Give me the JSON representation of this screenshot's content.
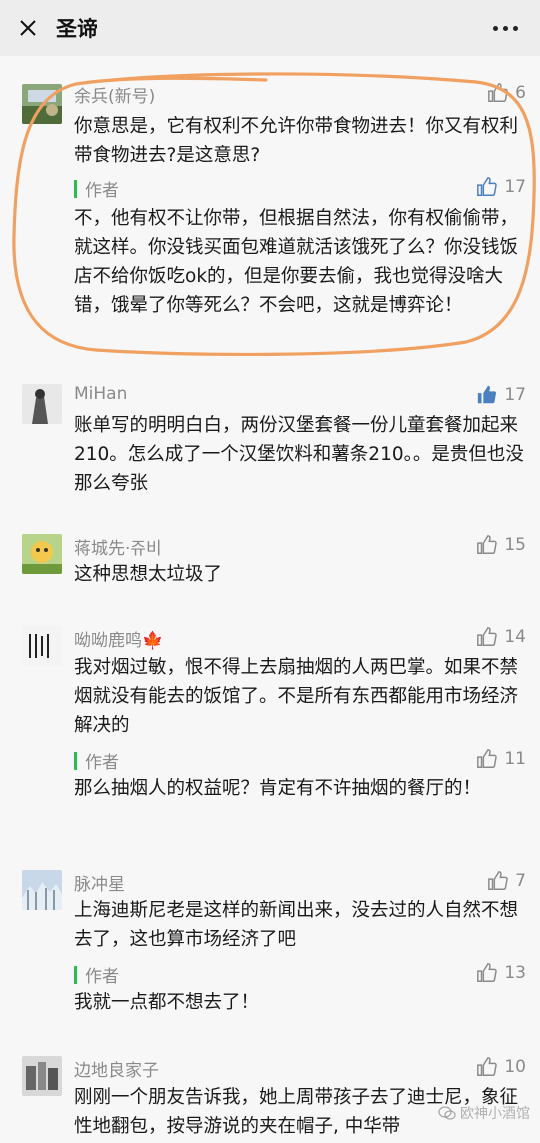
{
  "header": {
    "title": "圣谛"
  },
  "comments": [
    {
      "name": "余兵(新号)",
      "likes": "6",
      "text": "你意思是，它有权利不允许你带食物进去！你又有权利带食物进去?是这意思?",
      "reply": {
        "label": "作者",
        "likes": "17",
        "text": "不，他有权不让你带，但根据自然法，你有权偷偷带，就这样。你没钱买面包难道就活该饿死了么？你没钱饭店不给你饭吃ok的，但是你要去偷，我也觉得没啥大错，饿晕了你等死么？不会吧，这就是博弈论！"
      }
    },
    {
      "name": "MiHan",
      "likes": "17",
      "text": "账单写的明明白白，两份汉堡套餐一份儿童套餐加起来210。怎么成了一个汉堡饮料和薯条210。。是贵但也没那么夸张"
    },
    {
      "name": "蒋城先·쥬비",
      "likes": "15",
      "text": "这种思想太垃圾了"
    },
    {
      "name": "呦呦鹿鸣🍁",
      "likes": "14",
      "text": "我对烟过敏，恨不得上去扇抽烟的人两巴掌。如果不禁烟就没有能去的饭馆了。不是所有东西都能用市场经济解决的",
      "reply": {
        "label": "作者",
        "likes": "11",
        "text": "那么抽烟人的权益呢？肯定有不许抽烟的餐厅的！"
      }
    },
    {
      "name": "脉冲星",
      "likes": "7",
      "text": "上海迪斯尼老是这样的新闻出来，没去过的人自然不想去了，这也算市场经济了吧",
      "reply": {
        "label": "作者",
        "likes": "13",
        "text": "我就一点都不想去了！"
      }
    },
    {
      "name": "边地良家子",
      "likes": "10",
      "text": "刚刚一个朋友告诉我，她上周带孩子去了迪士尼，象征性地翻包，按导游说的夹在帽子, 中华带"
    }
  ],
  "watermark": "欧神小酒馆",
  "colors": {
    "accent": "#2bbd4e",
    "annotation": "#f0a060",
    "liked": "#4a7fc1"
  }
}
